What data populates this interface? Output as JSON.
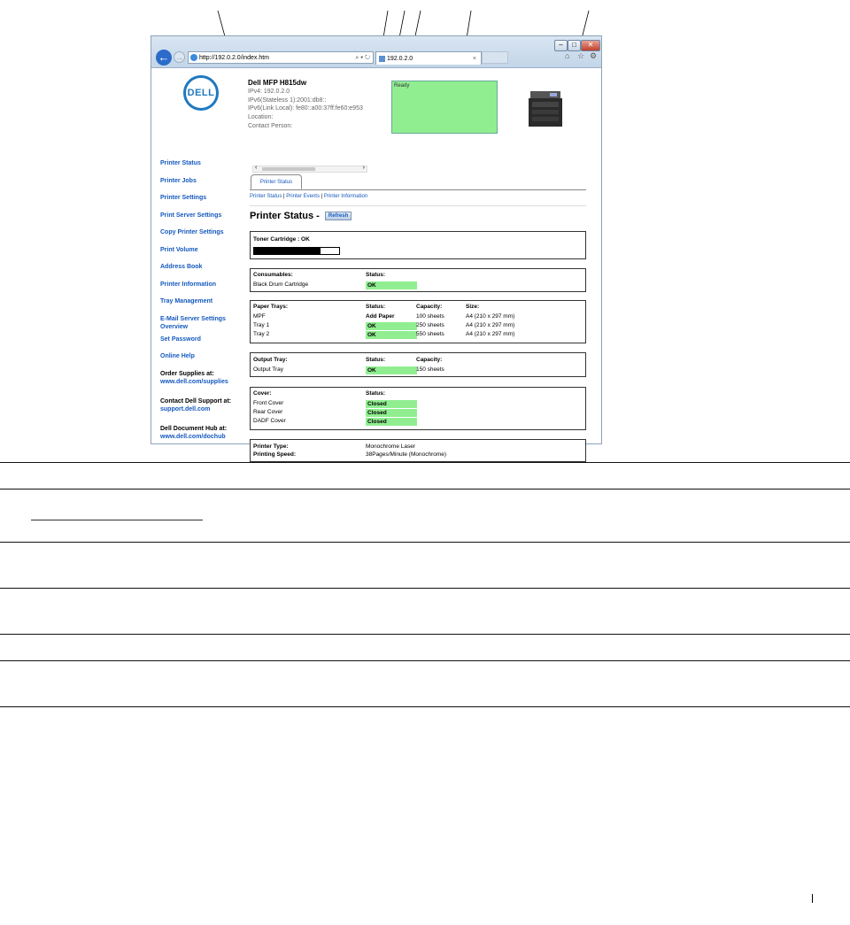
{
  "browser": {
    "url": "http://192.0.2.0/index.htm",
    "tab_title": "192.0.2.0",
    "tab_close": "×",
    "addr_controls": "⌕ ▾ ↻",
    "icons": [
      "back-icon",
      "forward-icon",
      "home-icon",
      "favorites-star-icon",
      "gear-icon"
    ],
    "window_buttons": [
      "–",
      "□",
      "✕"
    ]
  },
  "header": {
    "logo": "DELL",
    "model": "Dell MFP H815dw",
    "ipv4": "IPv4: 192.0.2.0",
    "ipv6_stateless": "IPv6(Stateless 1):2001:db8::",
    "ipv6_link_local": "IPv6(Link Local): fe80::a00:37ff:fe60:e953",
    "location": "Location:",
    "contact": "Contact Person:",
    "panel_status": "Ready"
  },
  "nav": {
    "items": [
      "Printer Status",
      "Printer Jobs",
      "Printer Settings",
      "Print Server Settings",
      "Copy Printer Settings",
      "Print Volume",
      "Address Book",
      "Printer Information",
      "Tray Management"
    ],
    "email_line1": "E-Mail Server Settings",
    "email_line2": "Overview",
    "set_password": "Set Password",
    "online_help": "Online Help",
    "order_label": "Order Supplies at:",
    "order_link": "www.dell.com/supplies",
    "support_label": "Contact Dell Support at:",
    "support_link": "support.dell.com",
    "hub_label": "Dell Document Hub at:",
    "hub_link": "www.dell.com/dochub"
  },
  "main": {
    "tab": "Printer Status",
    "sublink_status": "Printer Status",
    "sublink_events": "Printer Events",
    "sublink_info": "Printer Information",
    "sep": "|",
    "title": "Printer Status -",
    "refresh": "Refresh",
    "toner": {
      "label": "Toner Cartridge : OK",
      "level": 0.78
    },
    "consumables": {
      "h_item": "Consumables:",
      "h_status": "Status:",
      "rows": [
        {
          "item": "Black Drum Cartridge",
          "status": "OK"
        }
      ]
    },
    "paper": {
      "h_item": "Paper Trays:",
      "h_status": "Status:",
      "h_capacity": "Capacity:",
      "h_size": "Size:",
      "rows": [
        {
          "item": "MPF",
          "status": "Add Paper",
          "capacity": "100 sheets",
          "size": "A4 (210 x 297 mm)"
        },
        {
          "item": "Tray 1",
          "status": "OK",
          "capacity": "250 sheets",
          "size": "A4 (210 x 297 mm)"
        },
        {
          "item": "Tray 2",
          "status": "OK",
          "capacity": "550 sheets",
          "size": "A4 (210 x 297 mm)"
        }
      ]
    },
    "output": {
      "h_item": "Output Tray:",
      "h_status": "Status:",
      "h_capacity": "Capacity:",
      "rows": [
        {
          "item": "Output Tray",
          "status": "OK",
          "capacity": "150 sheets"
        }
      ]
    },
    "cover": {
      "h_item": "Cover:",
      "h_status": "Status:",
      "rows": [
        {
          "item": "Front Cover",
          "status": "Closed"
        },
        {
          "item": "Rear Cover",
          "status": "Closed"
        },
        {
          "item": "DADF Cover",
          "status": "Closed"
        }
      ]
    },
    "type_label": "Printer Type:",
    "type_value": "Monochrome Laser",
    "speed_label": "Printing Speed:",
    "speed_value": "38Pages/Minute (Monochrome)"
  }
}
